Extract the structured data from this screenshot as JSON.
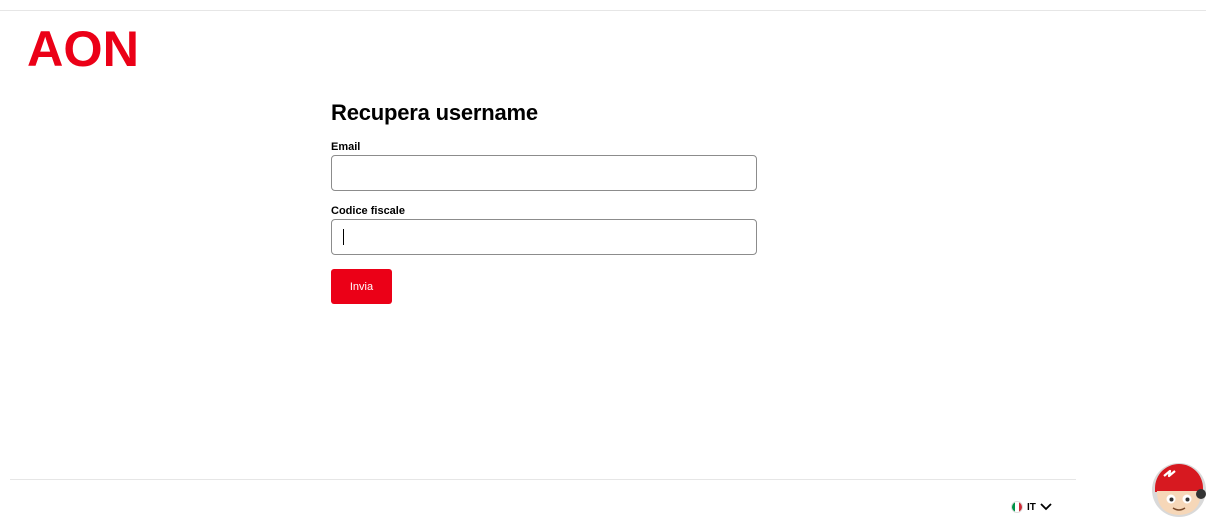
{
  "brand": {
    "logo_text": "AON",
    "accent_color": "#eb0017"
  },
  "form": {
    "title": "Recupera username",
    "email_label": "Email",
    "email_value": "",
    "fiscal_code_label": "Codice fiscale",
    "fiscal_code_value": "",
    "submit_label": "Invia"
  },
  "footer": {
    "language_code": "IT",
    "language_flag_icon": "italy-flag-icon",
    "dropdown_icon": "chevron-down-icon"
  },
  "chat": {
    "avatar_icon": "chatbot-avatar-icon"
  }
}
